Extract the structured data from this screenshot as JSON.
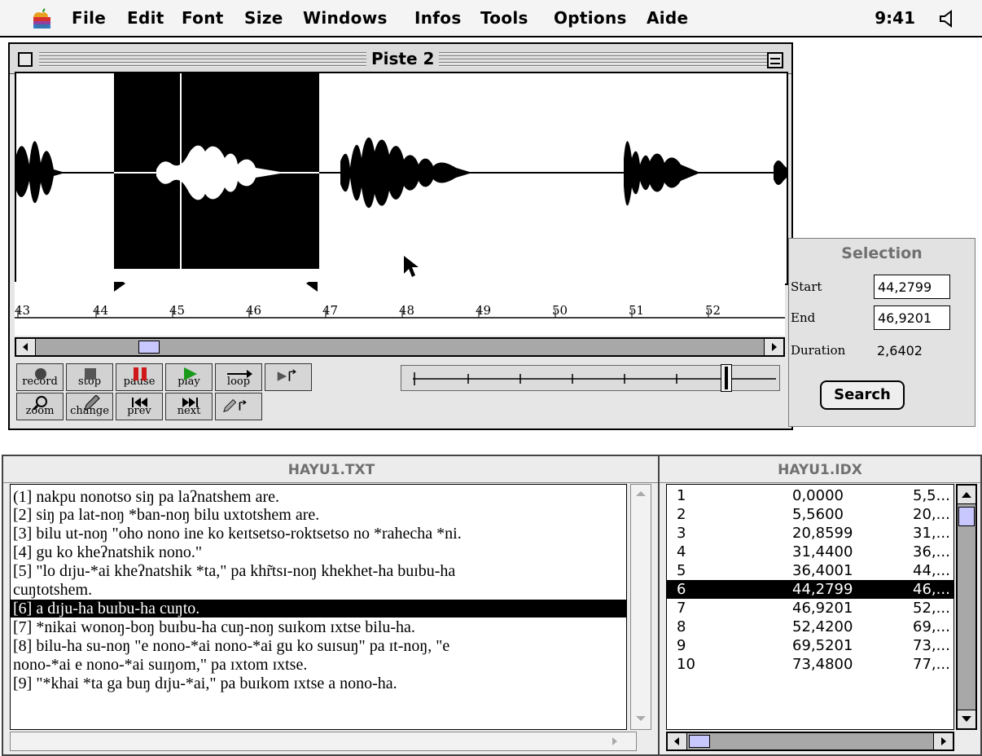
{
  "menubar": {
    "items": [
      "File",
      "Edit",
      "Font",
      "Size",
      "Windows",
      "Infos",
      "Tools",
      "Options",
      "Aide"
    ],
    "clock": "9:41"
  },
  "wave_window": {
    "title": "Piste 2",
    "ruler_ticks": [
      "43",
      "44",
      "45",
      "46",
      "47",
      "48",
      "49",
      "50",
      "51",
      "52"
    ],
    "transport_buttons": [
      "record",
      "stop",
      "pause",
      "play",
      "loop"
    ],
    "edit_buttons": [
      "zoom",
      "change",
      "prev",
      "next"
    ]
  },
  "selection_panel": {
    "title": "Selection",
    "start_label": "Start",
    "start_value": "44,2799",
    "end_label": "End",
    "end_value": "46,9201",
    "duration_label": "Duration",
    "duration_value": "2,6402",
    "search_label": "Search"
  },
  "text_window": {
    "title": "HAYU1.TXT",
    "lines": [
      "(1] nakpu nonotso siŋ pa laʔnatshem are.",
      "[2] siŋ pa lat-noŋ *ban-noŋ bilu uxtotshem are.",
      "[3] bilu ut-noŋ \"oho nono ine ko keɪtsetso-roktsetso no *rahecha *ni.",
      "[4] gu ko kheʔnatshik nono.\"",
      "[5] \"lo dɪju-*ai kheʔnatshik *ta,\" pa khr̃tsɪ-noŋ khekhet-ha buɪbu-ha",
      "cuŋtotshem.",
      "[6] a dɪju-ha buɪbu-ha cuŋto.",
      "[7] *nikai wonoŋ-boŋ buɪbu-ha cuŋ-noŋ suɪkom ɪxtse bilu-ha.",
      "[8] bilu-ha su-noŋ \"e nono-*ai nono-*ai gu ko suɪsuŋ\" pa ɪt-noŋ, \"e",
      "nono-*ai e nono-*ai suɪŋom,\" pa ɪxtom ɪxtse.",
      "[9] \"*khai *ta ga buŋ dɪju-*ai,\" pa buɪkom ɪxtse a nono-ha."
    ],
    "selected_line": 6
  },
  "index_window": {
    "title": "HAYU1.IDX",
    "rows": [
      {
        "n": "1",
        "start": "0,0000",
        "end": "5,5..."
      },
      {
        "n": "2",
        "start": "5,5600",
        "end": "20,..."
      },
      {
        "n": "3",
        "start": "20,8599",
        "end": "31,..."
      },
      {
        "n": "4",
        "start": "31,4400",
        "end": "36,..."
      },
      {
        "n": "5",
        "start": "36,4001",
        "end": "44,..."
      },
      {
        "n": "6",
        "start": "44,2799",
        "end": "46,..."
      },
      {
        "n": "7",
        "start": "46,9201",
        "end": "52,..."
      },
      {
        "n": "8",
        "start": "52,4200",
        "end": "69,..."
      },
      {
        "n": "9",
        "start": "69,5201",
        "end": "73,..."
      },
      {
        "n": "10",
        "start": "73,4800",
        "end": "77,..."
      }
    ],
    "selected_row": 5
  },
  "colors": {
    "selection": "#000000",
    "thumb": "#c8c8ff",
    "scroll_track": "#a8a8a8",
    "pause_icon": "#d01818",
    "play_icon": "#1a9a1a"
  }
}
